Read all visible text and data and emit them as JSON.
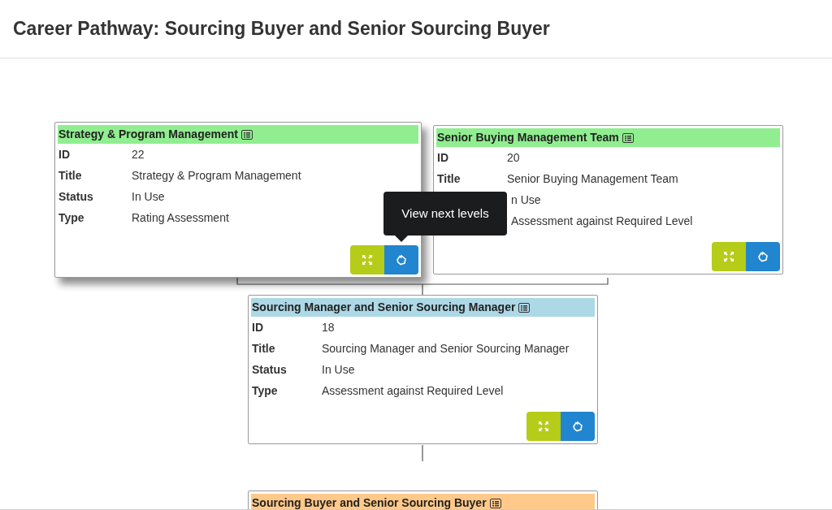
{
  "page_title": "Career Pathway: Sourcing Buyer and Senior Sourcing Buyer",
  "cards": [
    {
      "title": "Strategy & Program Management",
      "color": "#90ee90",
      "raised": true,
      "rows": [
        {
          "label": "ID",
          "value": "22"
        },
        {
          "label": "Title",
          "value": "Strategy & Program Management"
        },
        {
          "label": "Status",
          "value": "In Use"
        },
        {
          "label": "Type",
          "value": "Rating Assessment"
        }
      ],
      "buttons": true
    },
    {
      "title": "Senior Buying Management Team",
      "color": "#90ee90",
      "raised": false,
      "rows": [
        {
          "label": "ID",
          "value": "20"
        },
        {
          "label": "Title",
          "value": "Senior Buying Management Team"
        },
        {
          "value": "n Use"
        },
        {
          "value": "Assessment against Required Level"
        }
      ],
      "buttons": true
    },
    {
      "title": "Sourcing Manager and Senior Sourcing Manager",
      "color": "#add8e6",
      "raised": false,
      "rows": [
        {
          "label": "ID",
          "value": "18"
        },
        {
          "label": "Title",
          "value": "Sourcing Manager and Senior Sourcing Manager"
        },
        {
          "label": "Status",
          "value": "In Use"
        },
        {
          "label": "Type",
          "value": "Assessment against Required Level"
        }
      ],
      "buttons": true
    },
    {
      "title": "Sourcing Buyer and Senior Sourcing Buyer",
      "color": "#ffc98a",
      "raised": false,
      "buttons": false
    }
  ],
  "tooltip": "View next levels"
}
